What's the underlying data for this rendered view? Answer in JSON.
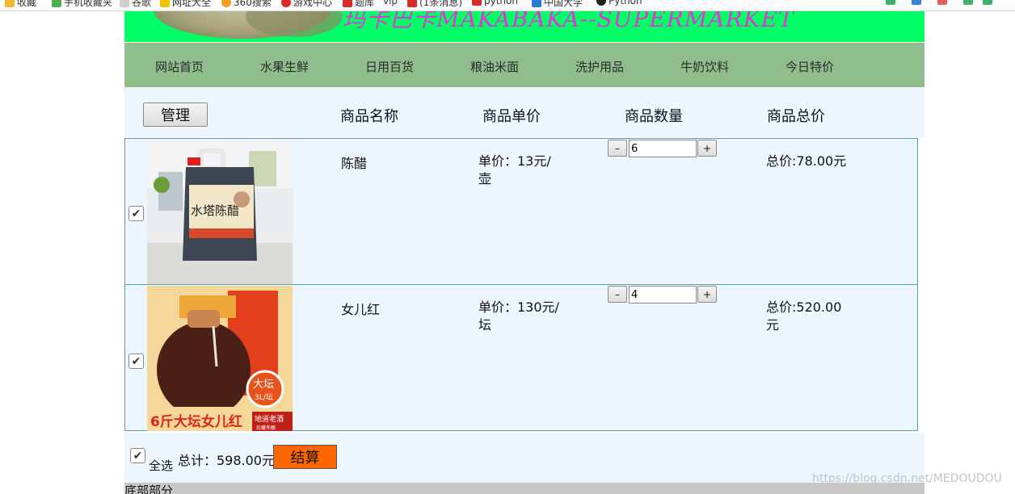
{
  "bookmarks": {
    "items": [
      {
        "label": "收藏",
        "icon": "star-icon",
        "color": "#f2b630"
      },
      {
        "label": "手机收藏夹",
        "icon": "phone-icon",
        "color": "#4caf50"
      },
      {
        "label": "谷歌",
        "icon": "page-icon",
        "color": "#cfcfcf"
      },
      {
        "label": "网址大全",
        "icon": "globe-icon",
        "color": "#f5c400"
      },
      {
        "label": "360搜索",
        "icon": "search-icon",
        "color": "#f0a020"
      },
      {
        "label": "游戏中心",
        "icon": "game-icon",
        "color": "#d62b2b"
      },
      {
        "label": "题库",
        "icon": "book-icon",
        "color": "#d62b2b"
      },
      {
        "label": "vip",
        "icon": "vip-icon",
        "color": "#888888"
      },
      {
        "label": "(1条消息)",
        "icon": "csdn-icon",
        "color": "#d62b2b"
      },
      {
        "label": "python",
        "icon": "csdn-icon",
        "color": "#d62b2b"
      },
      {
        "label": "中国大学",
        "icon": "mooc-icon",
        "color": "#2a7ad2"
      },
      {
        "label": "Python",
        "icon": "python-icon",
        "color": "#222222"
      }
    ]
  },
  "banner": {
    "title": "玛卡巴卡MAKABAKA--SUPERMARKET",
    "color": "#00ff66",
    "title_color": "#e433d6"
  },
  "nav": {
    "items": [
      {
        "label": "网站首页"
      },
      {
        "label": "水果生鲜"
      },
      {
        "label": "日用百货"
      },
      {
        "label": "粮油米面"
      },
      {
        "label": "洗护用品"
      },
      {
        "label": "牛奶饮料"
      },
      {
        "label": "今日特价"
      }
    ],
    "bg_color": "#8fbe8c"
  },
  "cart": {
    "manage_label": "管理",
    "headers": {
      "name": "商品名称",
      "price": "商品单价",
      "quantity": "商品数量",
      "total": "商品总价"
    },
    "items": [
      {
        "checked": true,
        "image": "vinegar-bottle-image",
        "image_text": "水塔陈醋",
        "name": "陈醋",
        "price_text": "单价：13元/壶",
        "qty_dec": "–",
        "qty": "6",
        "qty_inc": "+",
        "total_text": "总价:78.00元"
      },
      {
        "checked": true,
        "image": "huadiao-wine-jar-image",
        "image_text": "6斤大坛女儿红",
        "image_badge": "大坛",
        "image_badge_sub": "3L/坛",
        "image_corner": "地道老酒",
        "image_corner_sub": "珍藏冬酿",
        "name": "女儿红",
        "price_text": "单价：130元/坛",
        "qty_dec": "–",
        "qty": "4",
        "qty_inc": "+",
        "total_text": "总价:520.00元"
      }
    ],
    "select_all_label": "全选",
    "select_all_checked": true,
    "sum_text": "总计：598.00元",
    "checkout_label": "结算",
    "checkout_color": "#ff6600"
  },
  "footer": {
    "label": "底部部分"
  },
  "watermark": "https://blog.csdn.net/MEDOUDOU"
}
